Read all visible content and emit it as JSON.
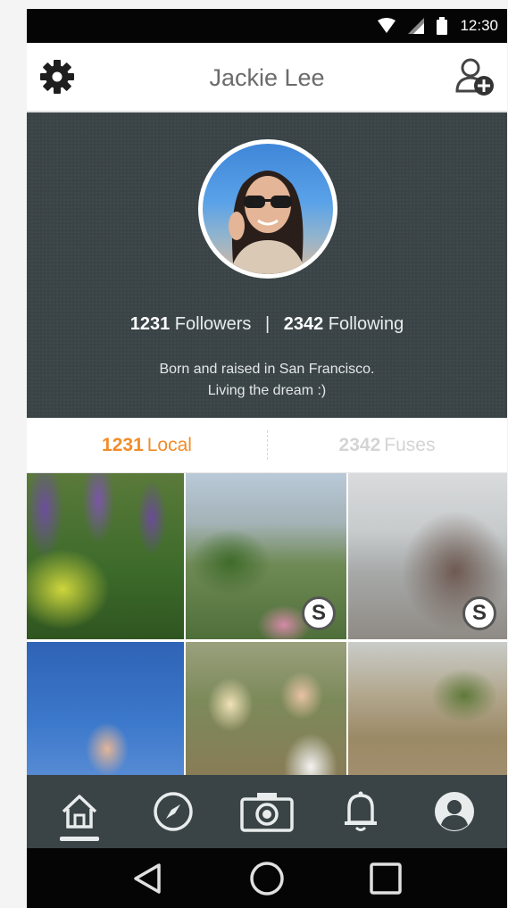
{
  "status_bar": {
    "time": "12:30"
  },
  "app_bar": {
    "title": "Jackie Lee"
  },
  "profile": {
    "followers_count": "1231",
    "followers_label": "Followers",
    "separator": "|",
    "following_count": "2342",
    "following_label": "Following",
    "bio_line1": "Born and raised in San Francisco.",
    "bio_line2": "Living the dream :)"
  },
  "tabs": [
    {
      "count": "1231",
      "label": "Local",
      "active": true
    },
    {
      "count": "2342",
      "label": "Fuses",
      "active": false
    }
  ],
  "grid": {
    "badge_letter": "S",
    "photos": [
      {
        "id": "photo-1",
        "badge": false
      },
      {
        "id": "photo-2",
        "badge": true
      },
      {
        "id": "photo-3",
        "badge": true
      },
      {
        "id": "photo-4",
        "badge": false
      },
      {
        "id": "photo-5",
        "badge": false
      },
      {
        "id": "photo-6",
        "badge": false
      }
    ]
  },
  "bottom_nav": [
    {
      "icon": "home-icon",
      "active": true
    },
    {
      "icon": "compass-icon",
      "active": false
    },
    {
      "icon": "camera-icon",
      "active": false
    },
    {
      "icon": "bell-icon",
      "active": false
    },
    {
      "icon": "profile-icon",
      "active": false
    }
  ],
  "colors": {
    "accent": "#f28c28",
    "header_bg": "#3a4447",
    "status_bar_bg": "#050505"
  }
}
